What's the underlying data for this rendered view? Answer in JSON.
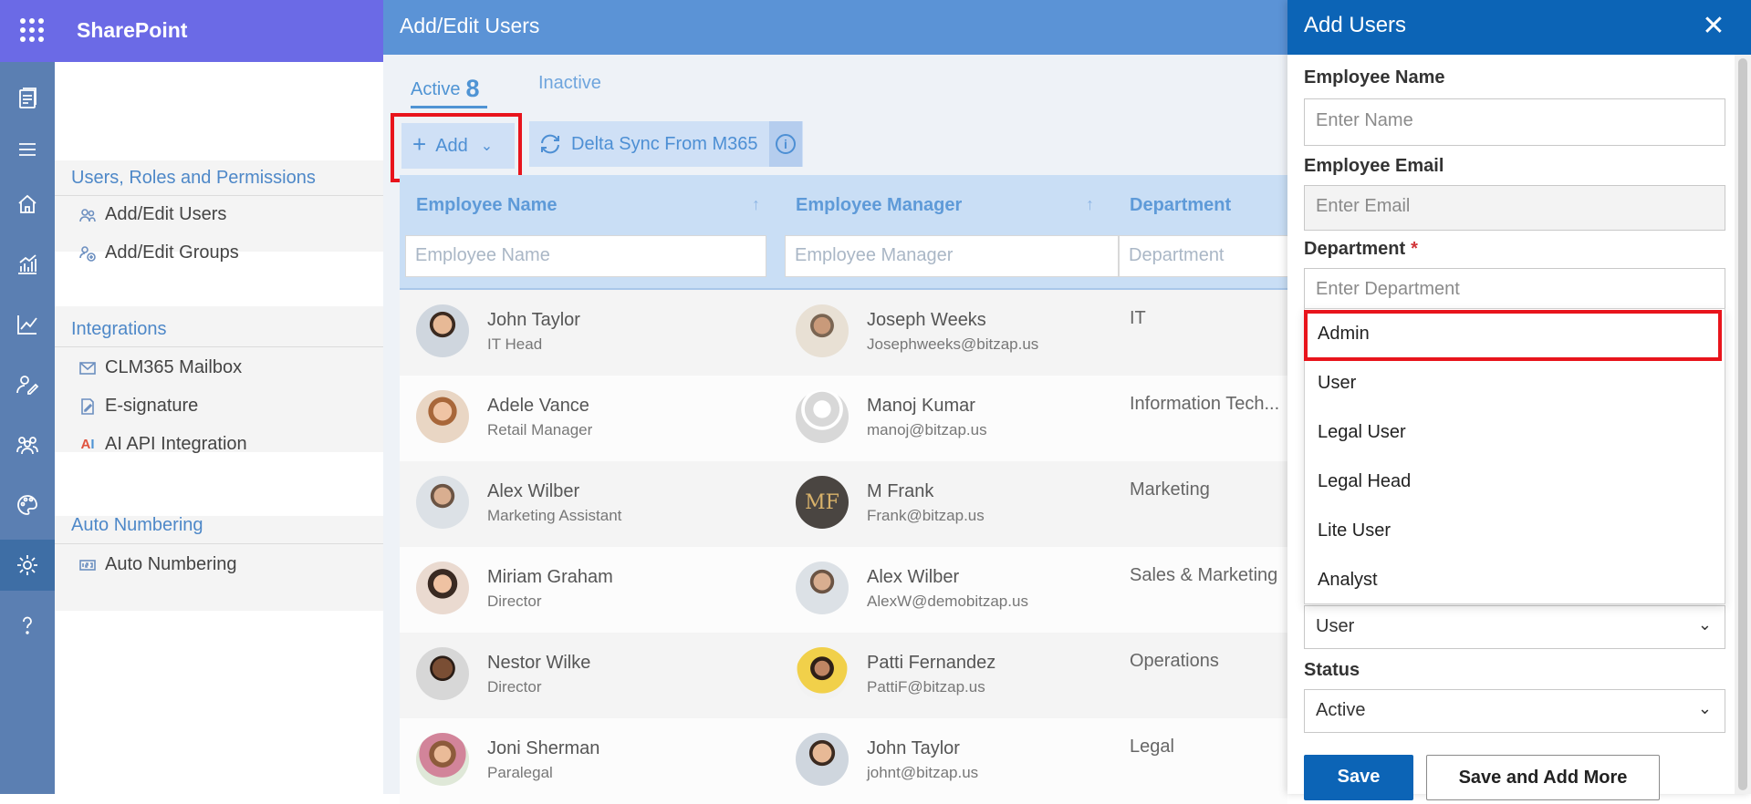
{
  "app": {
    "name": "SharePoint"
  },
  "rail": {
    "icons": [
      "clm-icon",
      "menu-icon",
      "home-icon",
      "analytics-icon",
      "trend-icon",
      "user-sign-icon",
      "team-icon",
      "palette-icon",
      "settings-icon",
      "help-icon"
    ],
    "active": "settings-icon"
  },
  "nav": {
    "sections": [
      {
        "title": "Users, Roles and Permissions",
        "items": [
          "Add/Edit Users",
          "Add/Edit Groups"
        ]
      },
      {
        "title": "Integrations",
        "items": [
          "CLM365 Mailbox",
          "E-signature",
          "AI API Integration"
        ]
      },
      {
        "title": "Auto Numbering",
        "items": [
          "Auto Numbering"
        ]
      }
    ]
  },
  "main": {
    "title": "Add/Edit Users",
    "tabs": {
      "active_label": "Active",
      "active_count": "8",
      "inactive_label": "Inactive"
    },
    "toolbar": {
      "add_label": "Add",
      "sync_label": "Delta Sync From M365"
    },
    "columns": {
      "name": "Employee Name",
      "manager": "Employee Manager",
      "department": "Department"
    },
    "filters": {
      "name": "Employee Name",
      "manager": "Employee Manager",
      "department": "Department"
    },
    "rows": [
      {
        "name": "John Taylor",
        "title": "IT Head",
        "manager": "Joseph Weeks",
        "manager_email": "Josephweeks@bitzap.us",
        "department": "IT"
      },
      {
        "name": "Adele Vance",
        "title": "Retail Manager",
        "manager": "Manoj Kumar",
        "manager_email": "manoj@bitzap.us",
        "department": "Information Tech..."
      },
      {
        "name": "Alex Wilber",
        "title": "Marketing Assistant",
        "manager": "M Frank",
        "manager_email": "Frank@bitzap.us",
        "department": "Marketing"
      },
      {
        "name": "Miriam Graham",
        "title": "Director",
        "manager": "Alex Wilber",
        "manager_email": "AlexW@demobitzap.us",
        "department": "Sales & Marketing"
      },
      {
        "name": "Nestor Wilke",
        "title": "Director",
        "manager": "Patti Fernandez",
        "manager_email": "PattiF@bitzap.us",
        "department": "Operations"
      },
      {
        "name": "Joni Sherman",
        "title": "Paralegal",
        "manager": "John Taylor",
        "manager_email": "johnt@bitzap.us",
        "department": "Legal"
      }
    ]
  },
  "panel": {
    "title": "Add Users",
    "employee_name": {
      "label": "Employee Name",
      "placeholder": "Enter Name"
    },
    "employee_email": {
      "label": "Employee Email",
      "placeholder": "Enter Email"
    },
    "department": {
      "label": "Department",
      "required": "*",
      "placeholder": "Enter Department",
      "options": [
        "Admin",
        "User",
        "Legal User",
        "Legal Head",
        "Lite User",
        "Analyst"
      ]
    },
    "role": {
      "value": "User"
    },
    "status": {
      "label": "Status",
      "value": "Active"
    },
    "save_label": "Save",
    "save_more_label": "Save and Add More"
  },
  "colors": {
    "brand": "#6b6ae6",
    "rail": "#5b7fb2",
    "primary": "#0c64b6",
    "accent": "#4f94d4",
    "highlight": "#e8141c"
  }
}
